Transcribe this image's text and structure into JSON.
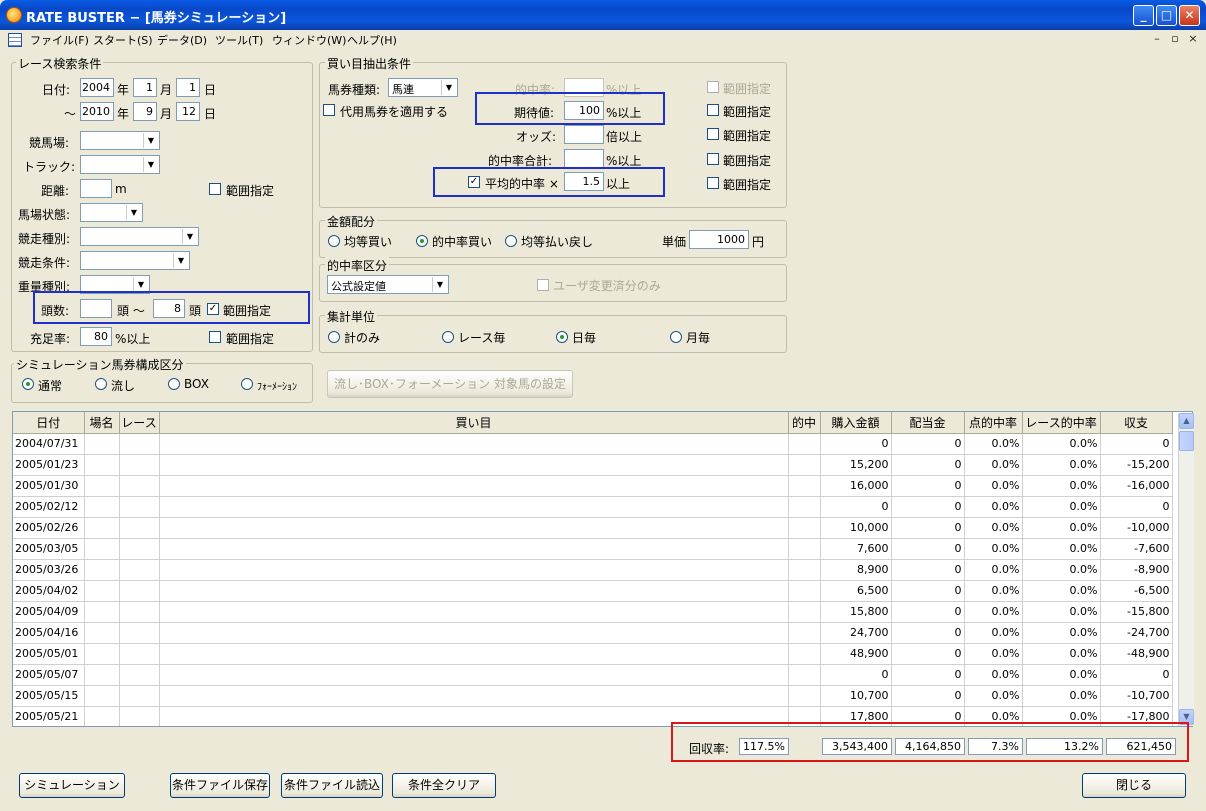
{
  "window": {
    "title": "RATE BUSTER − [馬券シミュレーション]"
  },
  "menu": {
    "items": [
      "ファイル(F)",
      "スタート(S)",
      "データ(D)",
      "ツール(T)",
      "ウィンドウ(W)",
      "ヘルプ(H)"
    ]
  },
  "race": {
    "legend": "レース検索条件",
    "date_label": "日付:",
    "year": "年",
    "month": "月",
    "day": "日",
    "tilde": "～",
    "from": {
      "y": "2004",
      "m": "1",
      "d": "1"
    },
    "to": {
      "y": "2010",
      "m": "9",
      "d": "12"
    },
    "course_label": "競馬場:",
    "track_label": "トラック:",
    "distance_label": "距離:",
    "distance_unit": "m",
    "range": "範囲指定",
    "condition_label": "馬場状態:",
    "kind_label": "競走種別:",
    "cond2_label": "競走条件:",
    "weight_label": "重量種別:",
    "heads_label": "頭数:",
    "heads_unit": "頭",
    "heads_to": "8",
    "fill_label": "充足率:",
    "fill_value": "80",
    "fill_unit": "%以上"
  },
  "sim": {
    "legend": "シミュレーション馬券構成区分",
    "opts": [
      "通常",
      "流し",
      "BOX",
      "ﾌｫｰﾒｰｼｮﾝ"
    ]
  },
  "buy": {
    "legend": "買い目抽出条件",
    "type_label": "馬券種類:",
    "type_value": "馬連",
    "substitute": "代用馬券を適用する",
    "hit_label": "的中率:",
    "pct_above": "%以上",
    "ev_label": "期待値:",
    "ev_value": "100",
    "odds_label": "オッズ:",
    "odds_unit": "倍以上",
    "hitsum_label": "的中率合計:",
    "avg_label": "平均的中率 ×",
    "avg_value": "1.5",
    "above": "以上",
    "range": "範囲指定"
  },
  "money": {
    "legend": "金額配分",
    "opts": [
      "均等買い",
      "的中率買い",
      "均等払い戻し"
    ],
    "unit_label": "単価",
    "unit_value": "1000",
    "yen": "円"
  },
  "hitclass": {
    "legend": "的中率区分",
    "value": "公式設定値",
    "user_only": "ユーザ変更済分のみ"
  },
  "agg": {
    "legend": "集計単位",
    "opts": [
      "計のみ",
      "レース毎",
      "日毎",
      "月毎"
    ]
  },
  "nagashi_btn": "流し･BOX･フォーメーション 対象馬の設定",
  "table": {
    "headers": [
      "日付",
      "場名",
      "レース",
      "買い目",
      "的中",
      "購入金額",
      "配当金",
      "点的中率",
      "レース的中率",
      "収支"
    ],
    "rows": [
      [
        "2004/07/31",
        "",
        "",
        "",
        "",
        "0",
        "0",
        "0.0%",
        "0.0%",
        "0"
      ],
      [
        "2005/01/23",
        "",
        "",
        "",
        "",
        "15,200",
        "0",
        "0.0%",
        "0.0%",
        "-15,200"
      ],
      [
        "2005/01/30",
        "",
        "",
        "",
        "",
        "16,000",
        "0",
        "0.0%",
        "0.0%",
        "-16,000"
      ],
      [
        "2005/02/12",
        "",
        "",
        "",
        "",
        "0",
        "0",
        "0.0%",
        "0.0%",
        "0"
      ],
      [
        "2005/02/26",
        "",
        "",
        "",
        "",
        "10,000",
        "0",
        "0.0%",
        "0.0%",
        "-10,000"
      ],
      [
        "2005/03/05",
        "",
        "",
        "",
        "",
        "7,600",
        "0",
        "0.0%",
        "0.0%",
        "-7,600"
      ],
      [
        "2005/03/26",
        "",
        "",
        "",
        "",
        "8,900",
        "0",
        "0.0%",
        "0.0%",
        "-8,900"
      ],
      [
        "2005/04/02",
        "",
        "",
        "",
        "",
        "6,500",
        "0",
        "0.0%",
        "0.0%",
        "-6,500"
      ],
      [
        "2005/04/09",
        "",
        "",
        "",
        "",
        "15,800",
        "0",
        "0.0%",
        "0.0%",
        "-15,800"
      ],
      [
        "2005/04/16",
        "",
        "",
        "",
        "",
        "24,700",
        "0",
        "0.0%",
        "0.0%",
        "-24,700"
      ],
      [
        "2005/05/01",
        "",
        "",
        "",
        "",
        "48,900",
        "0",
        "0.0%",
        "0.0%",
        "-48,900"
      ],
      [
        "2005/05/07",
        "",
        "",
        "",
        "",
        "0",
        "0",
        "0.0%",
        "0.0%",
        "0"
      ],
      [
        "2005/05/15",
        "",
        "",
        "",
        "",
        "10,700",
        "0",
        "0.0%",
        "0.0%",
        "-10,700"
      ],
      [
        "2005/05/21",
        "",
        "",
        "",
        "",
        "17,800",
        "0",
        "0.0%",
        "0.0%",
        "-17,800"
      ]
    ]
  },
  "totals": {
    "label": "回収率:",
    "rate": "117.5%",
    "purchase": "3,543,400",
    "payout": "4,164,850",
    "point_rate": "7.3%",
    "race_rate": "13.2%",
    "balance": "621,450"
  },
  "buttons": {
    "simulate": "シミュレーション",
    "save": "条件ファイル保存",
    "load": "条件ファイル読込",
    "clear": "条件全クリア",
    "close": "閉じる"
  }
}
